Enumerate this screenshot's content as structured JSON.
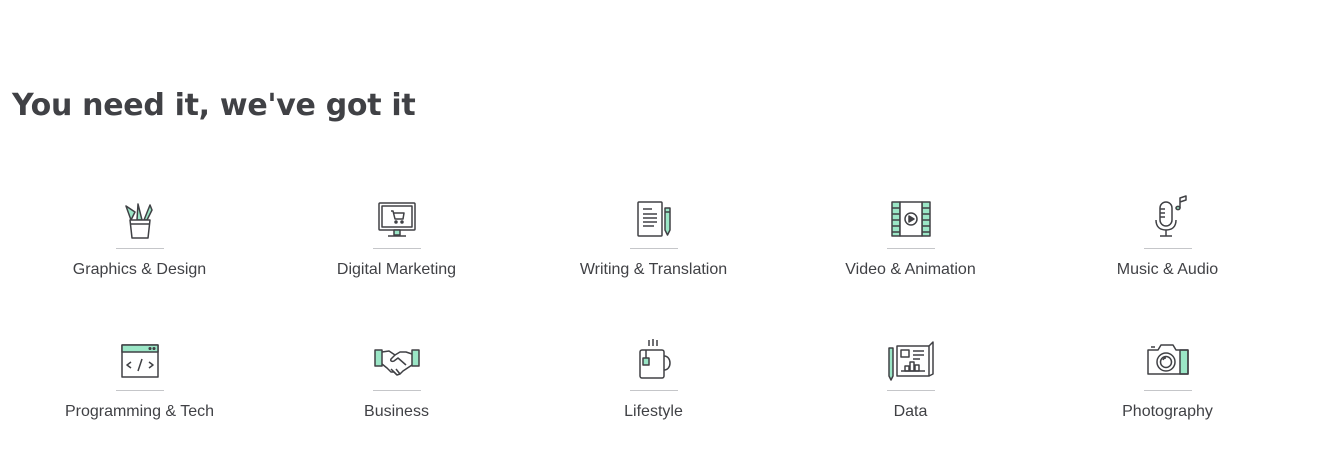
{
  "section": {
    "title": "You need it, we've got it"
  },
  "colors": {
    "accent_green": "#9be6c6",
    "icon_stroke": "#404145",
    "text": "#404145",
    "divider": "#c5c6c9"
  },
  "categories": [
    {
      "label": "Graphics & Design",
      "icon": "pencil-cup-icon"
    },
    {
      "label": "Digital Marketing",
      "icon": "monitor-cart-icon"
    },
    {
      "label": "Writing & Translation",
      "icon": "document-pen-icon"
    },
    {
      "label": "Video & Animation",
      "icon": "film-play-icon"
    },
    {
      "label": "Music & Audio",
      "icon": "microphone-note-icon"
    },
    {
      "label": "Programming & Tech",
      "icon": "code-window-icon"
    },
    {
      "label": "Business",
      "icon": "handshake-icon"
    },
    {
      "label": "Lifestyle",
      "icon": "tea-mug-icon"
    },
    {
      "label": "Data",
      "icon": "blueprint-chart-icon"
    },
    {
      "label": "Photography",
      "icon": "camera-icon"
    }
  ]
}
